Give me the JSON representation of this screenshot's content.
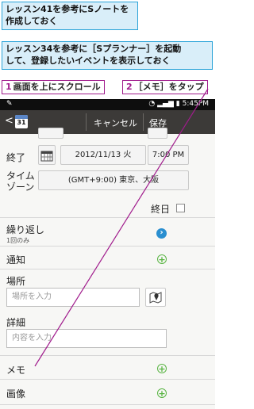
{
  "callouts": {
    "top": "レッスン41を参考にSノートを\n作成しておく",
    "second": "レッスン34を参考に［Sプランナー］を起動\nして、登録したいイベントを表示しておく"
  },
  "steps": {
    "step1_num": "1",
    "step1_text": "画面を上にスクロール",
    "step2_num": "2",
    "step2_text": "［メモ］をタップ"
  },
  "statusbar": {
    "time": "5:45PM"
  },
  "actionbar": {
    "calendar_day": "31",
    "cancel_label": "キャンセル",
    "save_label": "保存"
  },
  "form": {
    "end_label": "終了",
    "end_date": "2012/11/13 火",
    "end_time": "7:00 PM",
    "timezone_label": "タイム\nゾーン",
    "timezone_value": "(GMT+9:00) 東京、大阪",
    "allday_label": "終日",
    "repeat_label": "繰り返し",
    "repeat_value": "1回のみ",
    "notify_label": "通知",
    "place_label": "場所",
    "place_placeholder": "場所を入力",
    "detail_label": "詳細",
    "detail_placeholder": "内容を入力",
    "memo_label": "メモ",
    "image_label": "画像"
  },
  "colors": {
    "callout_bg": "#d9eef9",
    "callout_border": "#2aa3d8",
    "step_accent": "#a01b8c",
    "plus_green": "#5ab544",
    "actionbar": "#3c3a38"
  }
}
